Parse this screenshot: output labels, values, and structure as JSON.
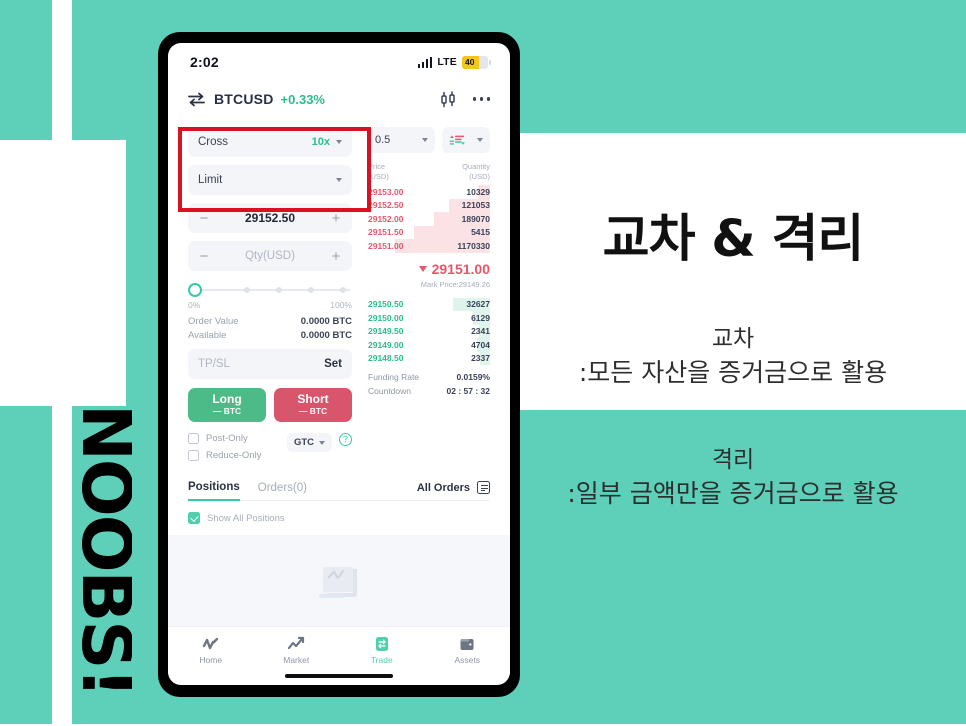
{
  "theme": {
    "teal": "#5ed0ba",
    "accent_green": "#2bbd8a",
    "accent_red": "#e5576b",
    "highlight_red": "#d81222",
    "long_green": "#4cbb87",
    "short_red": "#d9556b"
  },
  "decor": {
    "vertical_text": "NOOBS!"
  },
  "phone": {
    "status_bar": {
      "time": "2:02",
      "network": "LTE",
      "battery_level": "40",
      "signal_icon": "signal-bars-icon",
      "battery_icon": "battery-icon"
    },
    "app_bar": {
      "swap_icon": "swap-arrows-icon",
      "pair": "BTCUSD",
      "change": "+0.33%",
      "chart_icon": "candlestick-chart-icon",
      "more_icon": "more-dots-icon"
    },
    "order_form": {
      "margin_mode": "Cross",
      "leverage": "10x",
      "order_type": "Limit",
      "price_value": "29152.50",
      "qty_placeholder": "Qty(USD)",
      "minus_sign": "−",
      "plus_sign": "+",
      "slider_min": "0%",
      "slider_max": "100%",
      "order_value_label": "Order Value",
      "order_value": "0.0000 BTC",
      "available_label": "Available",
      "available_value": "0.0000 BTC",
      "tpsl_label": "TP/SL",
      "tpsl_action": "Set",
      "long_label": "Long",
      "long_sub": "— BTC",
      "short_label": "Short",
      "short_sub": "— BTC",
      "post_only": "Post-Only",
      "reduce_only": "Reduce-Only",
      "tif": "GTC",
      "help_icon": "question-circle-icon"
    },
    "order_book": {
      "tick_size": "0.5",
      "depth_icon": "order-book-depth-icon",
      "col_price_l1": "Price",
      "col_price_l2": "(USD)",
      "col_qty_l1": "Quantity",
      "col_qty_l2": "(USD)",
      "asks": [
        {
          "price": "29153.00",
          "qty": "10329",
          "depth": 10
        },
        {
          "price": "29152.50",
          "qty": "121053",
          "depth": 34
        },
        {
          "price": "29152.00",
          "qty": "189070",
          "depth": 46
        },
        {
          "price": "29151.50",
          "qty": "5415",
          "depth": 62
        },
        {
          "price": "29151.00",
          "qty": "1170330",
          "depth": 78
        }
      ],
      "last_price": "29151.00",
      "last_direction_icon": "triangle-down-icon",
      "mark_price": "Mark Price:29149.26",
      "bids": [
        {
          "price": "29150.50",
          "qty": "32627",
          "depth": 30
        },
        {
          "price": "29150.00",
          "qty": "6129",
          "depth": 14
        },
        {
          "price": "29149.50",
          "qty": "2341",
          "depth": 9
        },
        {
          "price": "29149.00",
          "qty": "4704",
          "depth": 11
        },
        {
          "price": "29148.50",
          "qty": "2337",
          "depth": 8
        }
      ],
      "funding_rate_label": "Funding Rate",
      "funding_rate_value": "0.0159%",
      "countdown_label": "Countdown",
      "countdown_value": "02 : 57 : 32"
    },
    "positions": {
      "tab_positions": "Positions",
      "tab_orders": "Orders(0)",
      "all_orders": "All Orders",
      "all_orders_icon": "list-icon",
      "show_all": "Show All Positions",
      "empty_icon": "empty-document-icon"
    },
    "tabbar": [
      {
        "label": "Home",
        "icon": "activity-pulse-icon",
        "active": false
      },
      {
        "label": "Market",
        "icon": "trend-chart-icon",
        "active": false
      },
      {
        "label": "Trade",
        "icon": "swap-square-icon",
        "active": true
      },
      {
        "label": "Assets",
        "icon": "wallet-icon",
        "active": false
      }
    ]
  },
  "right_panel": {
    "headline": "교차 & 격리",
    "cross": {
      "title": "교차",
      "desc": ":모든 자산을 증거금으로 활용"
    },
    "isolated": {
      "title": "격리",
      "desc": ":일부 금액만을 증거금으로 활용"
    }
  }
}
